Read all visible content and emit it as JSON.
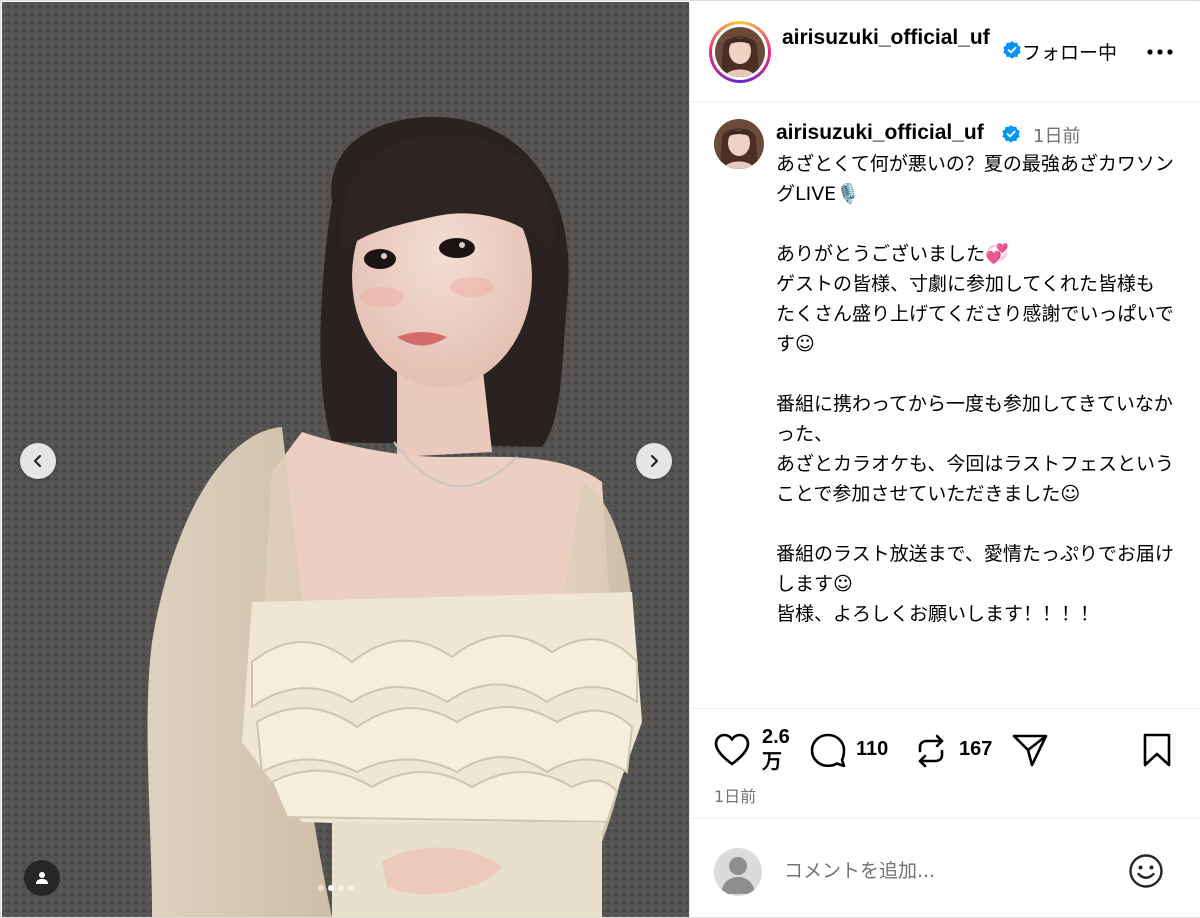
{
  "header": {
    "username": "airisuzuki_official_uf",
    "follow_status": "フォロー中",
    "more_icon": "more-horizontal-icon"
  },
  "caption": {
    "username": "airisuzuki_official_uf",
    "time_ago": "1日前",
    "text": "あざとくて何が悪いの？夏の最強あざカワソングLIVE🎙️\n\nありがとうございました💞\nゲストの皆様、寸劇に参加してくれた皆様も\nたくさん盛り上げてくださり感謝でいっぱいです☺︎\n\n番組に携わってから一度も参加してきていなかった、\nあざとカラオケも、今回はラストフェスということで参加させていただきました☺︎\n\n番組のラスト放送まで、愛情たっぷりでお届けします☺︎\n皆様、よろしくお願いします！！！！"
  },
  "actions": {
    "likes": "2.6万",
    "comments": "110",
    "reposts": "167",
    "date": "1日前"
  },
  "comment_box": {
    "placeholder": "コメントを追加..."
  },
  "carousel": {
    "total": 4,
    "active_index": 1
  },
  "colors": {
    "verified": "#0095f6",
    "secondary_text": "#737373",
    "border": "#efefef"
  }
}
